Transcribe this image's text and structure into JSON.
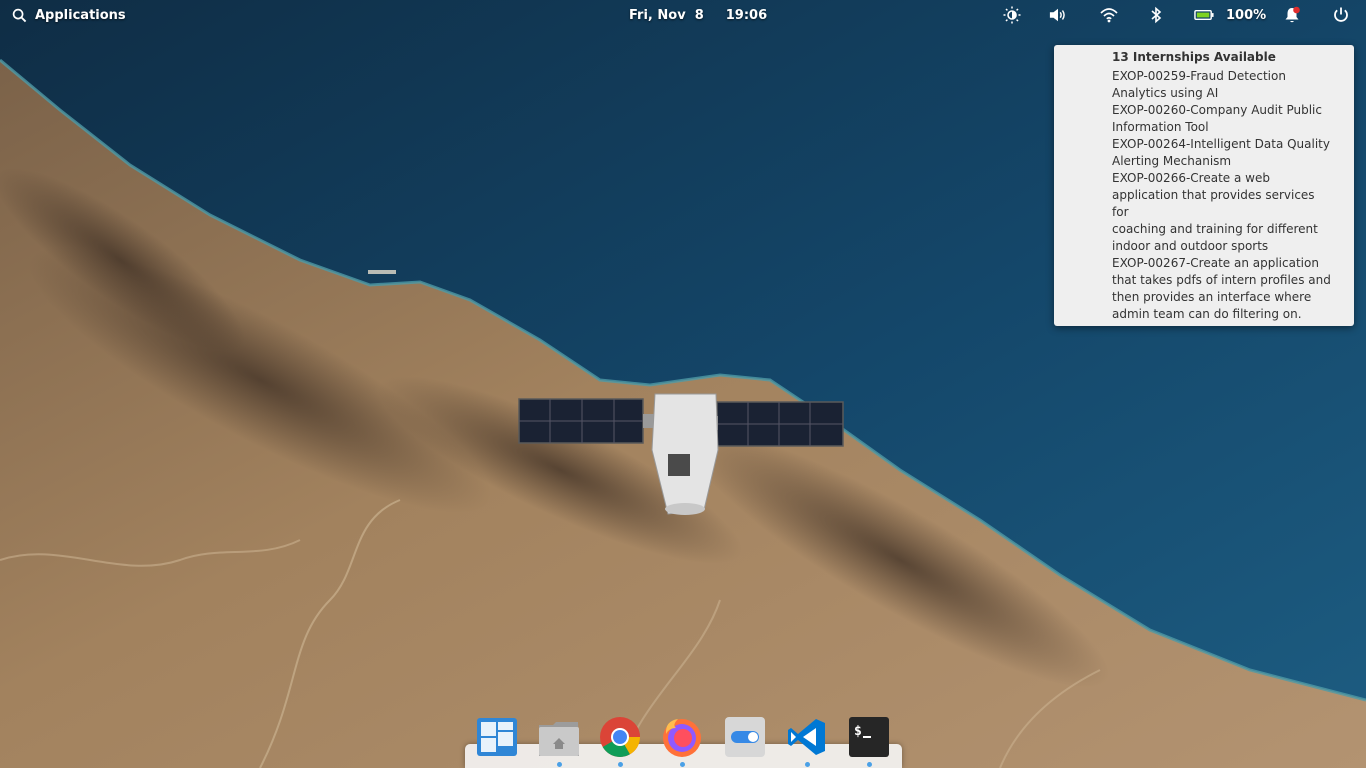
{
  "panel": {
    "applications_label": "Applications",
    "date": "Fri, Nov  8",
    "time": "19:06",
    "battery_percent": "100%",
    "icons": [
      "search-icon",
      "night-light-icon",
      "volume-icon",
      "wifi-icon",
      "bluetooth-icon",
      "battery-icon",
      "notifications-icon",
      "power-icon"
    ]
  },
  "notification": {
    "title": "13 Internships Available",
    "lines": [
      "EXOP-00259-Fraud Detection",
      "Analytics using AI",
      "EXOP-00260-Company Audit Public",
      "Information Tool",
      "EXOP-00264-Intelligent Data Quality",
      "Alerting Mechanism",
      "EXOP-00266-Create a web",
      "application that provides services for",
      "coaching and training for different",
      "indoor and outdoor sports",
      "EXOP-00267-Create an application",
      "that takes pdfs of intern profiles and",
      "then provides an interface where",
      "admin team can do filtering on."
    ]
  },
  "dock": {
    "items": [
      {
        "name": "multitasking-view",
        "icon": "multitasking-icon"
      },
      {
        "name": "files",
        "icon": "home-folder-icon"
      },
      {
        "name": "google-chrome",
        "icon": "chrome-icon"
      },
      {
        "name": "firefox",
        "icon": "firefox-icon"
      },
      {
        "name": "system-settings",
        "icon": "settings-toggle-icon"
      },
      {
        "name": "visual-studio-code",
        "icon": "vscode-icon"
      },
      {
        "name": "terminal",
        "icon": "terminal-icon"
      }
    ]
  },
  "colors": {
    "ocean": "#123e5c",
    "land": "#9c7d5c",
    "accent_blue": "#4aa0e6",
    "notification_bg": "#efefef"
  }
}
